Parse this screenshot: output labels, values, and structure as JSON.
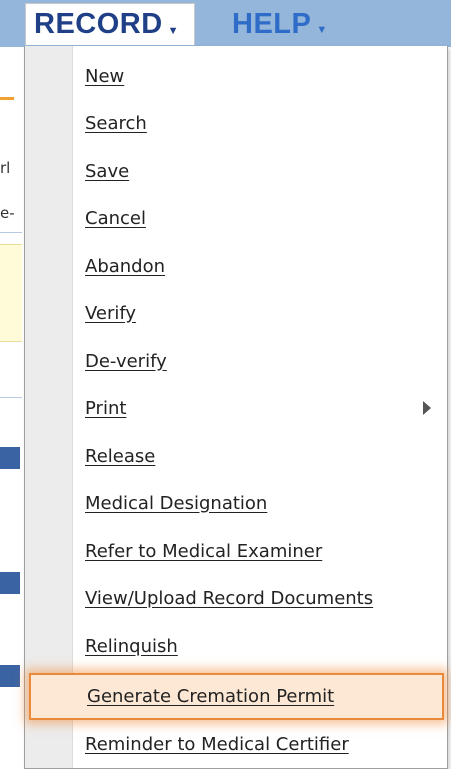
{
  "menubar": {
    "record_label": "RECORD",
    "help_label": "HELP",
    "bg_color": "#93b6da"
  },
  "background": {
    "snippet_1": "rl",
    "snippet_2": "e-"
  },
  "menu": {
    "items": [
      {
        "label": "New"
      },
      {
        "label": "Search"
      },
      {
        "label": "Save"
      },
      {
        "label": "Cancel"
      },
      {
        "label": "Abandon"
      },
      {
        "label": "Verify"
      },
      {
        "label": "De-verify"
      },
      {
        "label": "Print",
        "has_submenu": true
      },
      {
        "label": "Release"
      },
      {
        "label": "Medical Designation"
      },
      {
        "label": "Refer to Medical Examiner"
      },
      {
        "label": "View/Upload Record Documents"
      },
      {
        "label": "Relinquish"
      },
      {
        "label": "Generate Cremation Permit",
        "highlighted": true
      },
      {
        "label": "Reminder to Medical Certifier"
      }
    ],
    "highlight_color": "#e8893c"
  }
}
